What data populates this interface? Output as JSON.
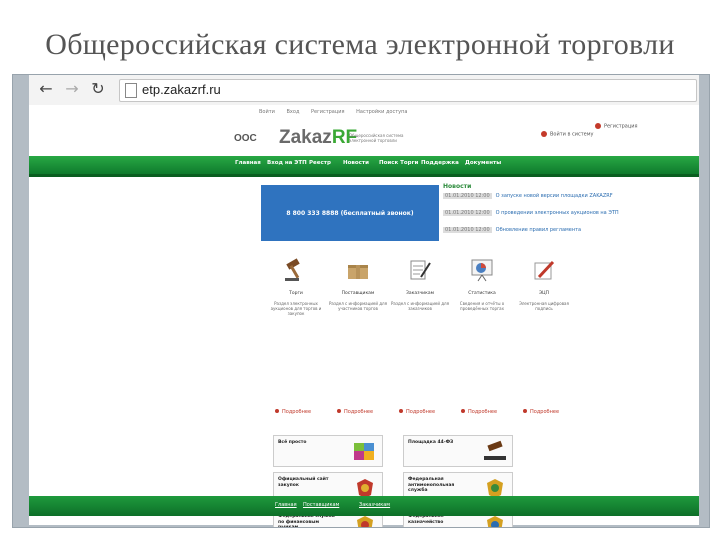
{
  "slide": {
    "title": "Общероссийская система электронной торговли"
  },
  "browser": {
    "url": "etp.zakazrf.ru"
  },
  "site": {
    "top_links": [
      "Войти",
      "Вход",
      "Регистрация",
      "Настройки доступа"
    ],
    "logo_left": "ООС",
    "logo_brand_a": "Zakaz",
    "logo_brand_b": "RF",
    "logo_tagline": "Общероссийская система электронной торговли",
    "login_label": "Войти в систему",
    "register_label": "Регистрация",
    "menu": [
      "Главная",
      "Вход на ЭТП",
      "Реестр",
      "Новости",
      "Поиск Торги",
      "Поддержка",
      "Документы"
    ],
    "banner_text": "8 800 333 8888 (бесплатный звонок)",
    "news_title": "Новости",
    "news": [
      {
        "date": "01.01.2010 12:00",
        "text": "О запуске новой версии площадки ZAKAZRF"
      },
      {
        "date": "01.01.2010 12:00",
        "text": "О проведении электронных аукционов на ЭТП"
      },
      {
        "date": "01.01.2010 12:00",
        "text": "Обновление правил регламента"
      }
    ],
    "features": [
      {
        "label": "Торги",
        "desc": "Раздел электронных аукционов для торгов и закупок"
      },
      {
        "label": "Поставщикам",
        "desc": "Раздел с информацией для участников торгов"
      },
      {
        "label": "Заказчикам",
        "desc": "Раздел с информацией для заказчиков"
      },
      {
        "label": "Статистика",
        "desc": "Сведения и отчёты о проведённых торгах"
      },
      {
        "label": "ЭЦП",
        "desc": "Электронная цифровая подпись"
      }
    ],
    "more_label": "Подробнее",
    "cards": [
      {
        "text": "Всё просто",
        "icon": "puzzle-icon"
      },
      {
        "text": "Площадка 44-ФЗ",
        "icon": "gavel-icon"
      },
      {
        "text": "Официальный сайт закупок",
        "icon": "emblem-icon"
      },
      {
        "text": "Федеральная антимонопольная служба",
        "icon": "emblem-icon"
      },
      {
        "text": "Федеральная служба по финансовым рынкам",
        "icon": "emblem-icon"
      },
      {
        "text": "Федеральное казначейство",
        "icon": "emblem-icon"
      }
    ],
    "footer_links": [
      "Главная",
      "Поставщикам",
      "Заказчикам"
    ]
  }
}
